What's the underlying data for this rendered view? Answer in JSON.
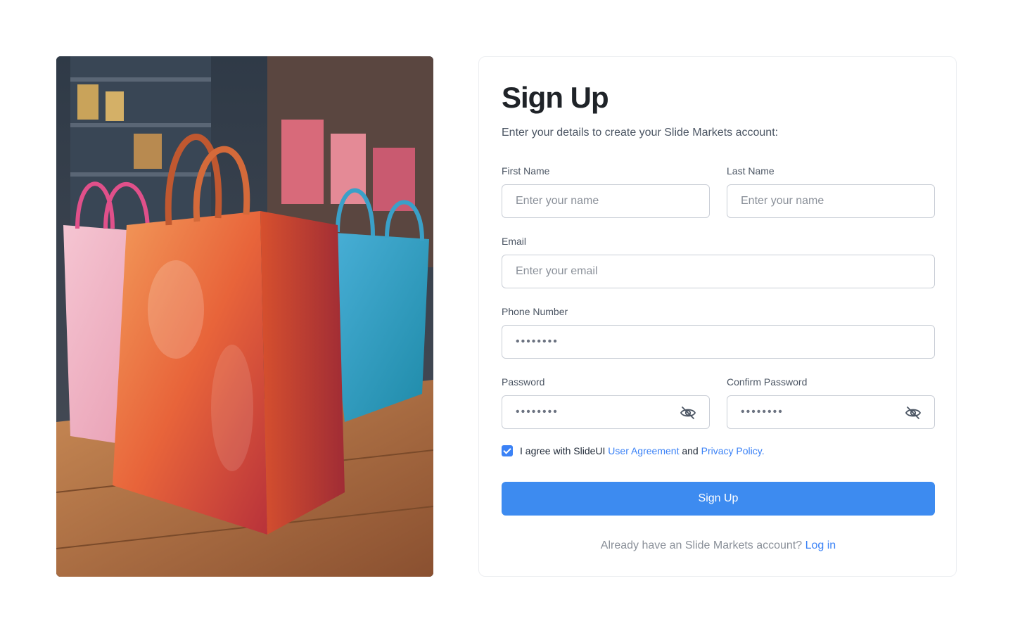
{
  "signup": {
    "title": "Sign Up",
    "subtitle": "Enter your details to create your Slide Markets account:",
    "first_name": {
      "label": "First Name",
      "placeholder": "Enter your name"
    },
    "last_name": {
      "label": "Last Name",
      "placeholder": "Enter your name"
    },
    "email": {
      "label": "Email",
      "placeholder": "Enter your email"
    },
    "phone": {
      "label": "Phone Number",
      "value": "••••••••"
    },
    "password": {
      "label": "Password",
      "value": "••••••••"
    },
    "confirm_password": {
      "label": "Confirm Password",
      "value": "••••••••"
    },
    "agree": {
      "checked": true,
      "prefix": "I agree with SlideUI ",
      "user_agreement": "User Agreement",
      "and": " and ",
      "privacy_policy": "Privacy Policy."
    },
    "submit_label": "Sign Up",
    "footer_text": "Already have an Slide Markets account? ",
    "login_link": "Log in"
  },
  "icons": {
    "password_toggle": "eye-off-icon"
  },
  "colors": {
    "accent": "#3d8bf0",
    "link": "#3b82f6"
  }
}
